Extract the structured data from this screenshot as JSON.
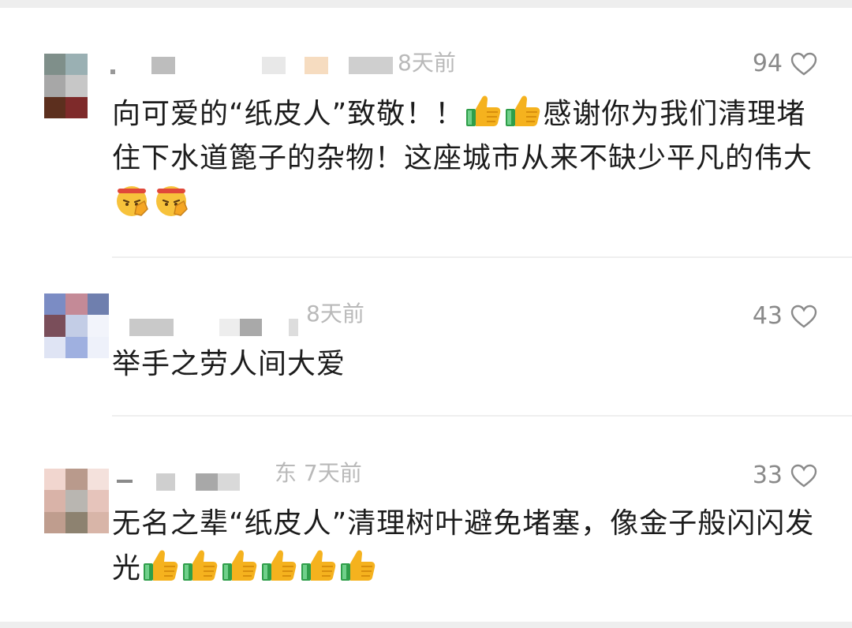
{
  "comments": [
    {
      "time": "8天前",
      "likes": "94",
      "text_a": "向可爱的“纸皮人”致敬！！",
      "emoji_a": [
        "thumbs-up-icon",
        "thumbs-up-icon"
      ],
      "text_b": "感谢你为我们清理堵住下水道篦子的杂物！这座城市从来不缺少平凡的伟大",
      "emoji_b": [
        "salute-face-icon",
        "salute-face-icon"
      ]
    },
    {
      "time": "8天前",
      "likes": "43",
      "text_a": "举手之劳人间大爱"
    },
    {
      "time": "东 7天前",
      "likes": "33",
      "text_a": "无名之辈“纸皮人”清理树叶避免堵塞，像金子般闪闪发光",
      "emoji_a": [
        "thumbs-up-icon",
        "thumbs-up-icon",
        "thumbs-up-icon",
        "thumbs-up-icon",
        "thumbs-up-icon",
        "thumbs-up-icon"
      ]
    }
  ],
  "colors": {
    "text": "#1c1c1c",
    "meta": "#b9b9b9",
    "count": "#8a8a8a",
    "thumb": "#f5b21e",
    "cuff": "#2f9e4a"
  }
}
